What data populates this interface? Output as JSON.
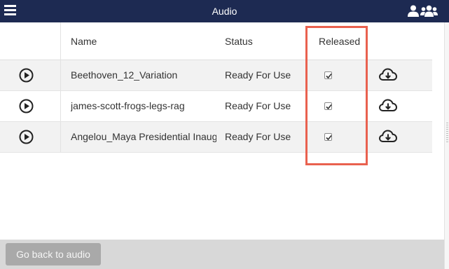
{
  "header": {
    "title": "Audio"
  },
  "table": {
    "columns": {
      "name": "Name",
      "status": "Status",
      "released": "Released"
    },
    "rows": [
      {
        "name": "Beethoven_12_Variation",
        "status": "Ready For Use",
        "released": true
      },
      {
        "name": "james-scott-frogs-legs-rag",
        "status": "Ready For Use",
        "released": true
      },
      {
        "name": "Angelou_Maya Presidential Inaugural Poem",
        "status": "Ready For Use",
        "released": true
      }
    ]
  },
  "footer": {
    "back_label": "Go back to audio"
  },
  "colors": {
    "header_bg": "#1d2a52",
    "highlight": "#e9614f",
    "stripe": "#f2f2f2"
  }
}
